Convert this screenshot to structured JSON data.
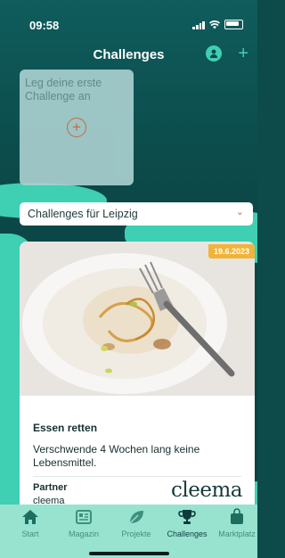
{
  "status_bar": {
    "time": "09:58"
  },
  "header": {
    "title": "Challenges"
  },
  "create_card": {
    "text": "Leg deine erste Challenge an"
  },
  "city_select": {
    "value": "Challenges für Leipzig"
  },
  "challenge": {
    "date": "19.6.2023",
    "title": "Essen retten",
    "description": "Verschwende 4 Wochen lang keine Lebensmittel.",
    "partner_label": "Partner",
    "partner_name": "cleema",
    "partner_logo": "cleema"
  },
  "tabs": [
    {
      "label": "Start",
      "icon": "home-icon"
    },
    {
      "label": "Magazin",
      "icon": "newspaper-icon"
    },
    {
      "label": "Projekte",
      "icon": "leaf-icon"
    },
    {
      "label": "Challenges",
      "icon": "trophy-icon",
      "active": true
    },
    {
      "label": "Marktplatz",
      "icon": "shopping-bag-icon"
    }
  ],
  "colors": {
    "accent": "#d86b3b",
    "mint": "#3fcfb2",
    "dark": "#0d4a4a",
    "tabbar": "#98e3d0",
    "date_badge": "#f0b43a"
  }
}
